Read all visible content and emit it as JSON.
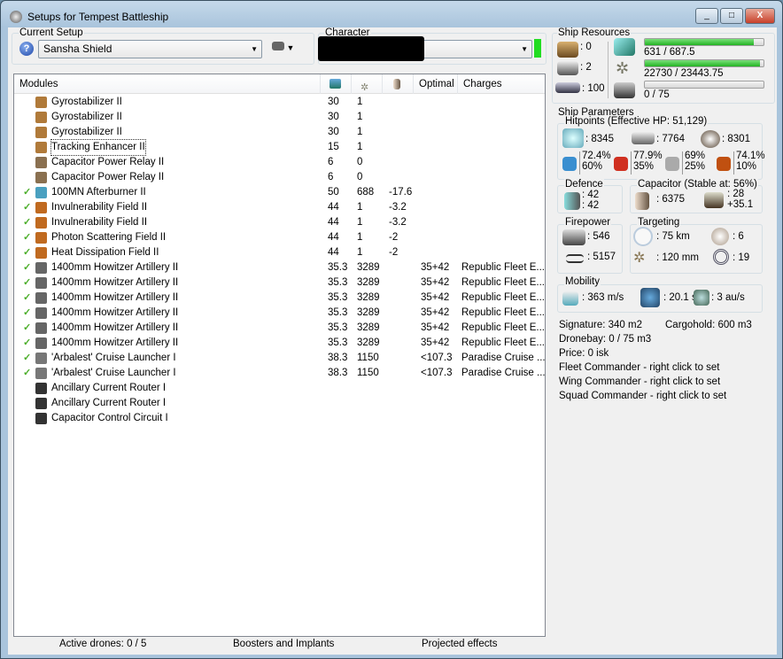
{
  "window": {
    "title": "Setups for Tempest Battleship",
    "min": "_",
    "max": "□",
    "close": "X"
  },
  "setup": {
    "label": "Current Setup",
    "value": "Sansha Shield"
  },
  "character": {
    "label": "Character",
    "value": ""
  },
  "modules": {
    "headers": [
      "Modules",
      "",
      "",
      "",
      "Optimal",
      "Charges"
    ],
    "rows": [
      {
        "active": false,
        "icon": "gyrostabilizer-icon",
        "name": "Gyrostabilizer II",
        "cpu": "30",
        "pg": "1",
        "cap": "",
        "optimal": "",
        "charges": "",
        "color": "#b07a3a"
      },
      {
        "active": false,
        "icon": "gyrostabilizer-icon",
        "name": "Gyrostabilizer II",
        "cpu": "30",
        "pg": "1",
        "cap": "",
        "optimal": "",
        "charges": "",
        "color": "#b07a3a"
      },
      {
        "active": false,
        "icon": "gyrostabilizer-icon",
        "name": "Gyrostabilizer II",
        "cpu": "30",
        "pg": "1",
        "cap": "",
        "optimal": "",
        "charges": "",
        "color": "#b07a3a"
      },
      {
        "active": false,
        "icon": "tracking-enhancer-icon",
        "name": "Tracking Enhancer II",
        "cpu": "15",
        "pg": "1",
        "cap": "",
        "optimal": "",
        "charges": "",
        "color": "#b07a3a"
      },
      {
        "active": false,
        "icon": "capacitor-relay-icon",
        "name": "Capacitor Power Relay II",
        "cpu": "6",
        "pg": "0",
        "cap": "",
        "optimal": "",
        "charges": "",
        "color": "#8a7050"
      },
      {
        "active": false,
        "icon": "capacitor-relay-icon",
        "name": "Capacitor Power Relay II",
        "cpu": "6",
        "pg": "0",
        "cap": "",
        "optimal": "",
        "charges": "",
        "color": "#8a7050"
      },
      {
        "active": true,
        "icon": "afterburner-icon",
        "name": "100MN Afterburner II",
        "cpu": "50",
        "pg": "688",
        "cap": "-17.6",
        "optimal": "",
        "charges": "",
        "color": "#4aa0c0"
      },
      {
        "active": true,
        "icon": "shield-hardener-icon",
        "name": "Invulnerability Field II",
        "cpu": "44",
        "pg": "1",
        "cap": "-3.2",
        "optimal": "",
        "charges": "",
        "color": "#c06a20"
      },
      {
        "active": true,
        "icon": "shield-hardener-icon",
        "name": "Invulnerability Field II",
        "cpu": "44",
        "pg": "1",
        "cap": "-3.2",
        "optimal": "",
        "charges": "",
        "color": "#c06a20"
      },
      {
        "active": true,
        "icon": "shield-hardener-icon",
        "name": "Photon Scattering Field II",
        "cpu": "44",
        "pg": "1",
        "cap": "-2",
        "optimal": "",
        "charges": "",
        "color": "#c06a20"
      },
      {
        "active": true,
        "icon": "shield-hardener-icon",
        "name": "Heat Dissipation Field II",
        "cpu": "44",
        "pg": "1",
        "cap": "-2",
        "optimal": "",
        "charges": "",
        "color": "#c06a20"
      },
      {
        "active": true,
        "icon": "artillery-icon",
        "name": "1400mm Howitzer Artillery II",
        "cpu": "35.3",
        "pg": "3289",
        "cap": "",
        "optimal": "35+42",
        "charges": "Republic Fleet E...",
        "color": "#666"
      },
      {
        "active": true,
        "icon": "artillery-icon",
        "name": "1400mm Howitzer Artillery II",
        "cpu": "35.3",
        "pg": "3289",
        "cap": "",
        "optimal": "35+42",
        "charges": "Republic Fleet E...",
        "color": "#666"
      },
      {
        "active": true,
        "icon": "artillery-icon",
        "name": "1400mm Howitzer Artillery II",
        "cpu": "35.3",
        "pg": "3289",
        "cap": "",
        "optimal": "35+42",
        "charges": "Republic Fleet E...",
        "color": "#666"
      },
      {
        "active": true,
        "icon": "artillery-icon",
        "name": "1400mm Howitzer Artillery II",
        "cpu": "35.3",
        "pg": "3289",
        "cap": "",
        "optimal": "35+42",
        "charges": "Republic Fleet E...",
        "color": "#666"
      },
      {
        "active": true,
        "icon": "artillery-icon",
        "name": "1400mm Howitzer Artillery II",
        "cpu": "35.3",
        "pg": "3289",
        "cap": "",
        "optimal": "35+42",
        "charges": "Republic Fleet E...",
        "color": "#666"
      },
      {
        "active": true,
        "icon": "artillery-icon",
        "name": "1400mm Howitzer Artillery II",
        "cpu": "35.3",
        "pg": "3289",
        "cap": "",
        "optimal": "35+42",
        "charges": "Republic Fleet E...",
        "color": "#666"
      },
      {
        "active": true,
        "icon": "launcher-icon",
        "name": "'Arbalest' Cruise Launcher I",
        "cpu": "38.3",
        "pg": "1150",
        "cap": "",
        "optimal": "<107.3",
        "charges": "Paradise Cruise ...",
        "color": "#777"
      },
      {
        "active": true,
        "icon": "launcher-icon",
        "name": "'Arbalest' Cruise Launcher I",
        "cpu": "38.3",
        "pg": "1150",
        "cap": "",
        "optimal": "<107.3",
        "charges": "Paradise Cruise ...",
        "color": "#777"
      },
      {
        "active": false,
        "icon": "rig-icon",
        "name": "Ancillary Current Router I",
        "cpu": "",
        "pg": "",
        "cap": "",
        "optimal": "",
        "charges": "",
        "color": "#333"
      },
      {
        "active": false,
        "icon": "rig-icon",
        "name": "Ancillary Current Router I",
        "cpu": "",
        "pg": "",
        "cap": "",
        "optimal": "",
        "charges": "",
        "color": "#333"
      },
      {
        "active": false,
        "icon": "rig-icon",
        "name": "Capacitor Control Circuit I",
        "cpu": "",
        "pg": "",
        "cap": "",
        "optimal": "",
        "charges": "",
        "color": "#333"
      }
    ]
  },
  "resources": {
    "label": "Ship Resources",
    "turrets": ": 0",
    "launchers": ": 2",
    "calibration": ": 100",
    "cpu": {
      "text": "631 / 687.5",
      "fraction": 0.918
    },
    "powergrid": {
      "text": "22730 / 23443.75",
      "fraction": 0.97
    },
    "drone_bandwidth": {
      "text": "0 / 75",
      "fraction": 0
    }
  },
  "params": {
    "label": "Ship Parameters",
    "hitpoints_label": "Hitpoints (Effective HP: 51,129)",
    "shield": ": 8345",
    "armor": ": 7764",
    "hull": ": 8301",
    "resists": [
      {
        "a": "72.4%",
        "b": "60%"
      },
      {
        "a": "77.9%",
        "b": "35%"
      },
      {
        "a": "69%",
        "b": "25%"
      },
      {
        "a": "74.1%",
        "b": "10%"
      }
    ],
    "defence_label": "Defence",
    "defence_a": ": 42",
    "defence_b": ": 42",
    "capacitor_label": "Capacitor (Stable at: 56%)",
    "cap_amount": ": 6375",
    "cap_a": ": 28",
    "cap_b": "+35.1",
    "firepower_label": "Firepower",
    "dps": ": 546",
    "volley": ": 5157",
    "targeting_label": "Targeting",
    "range": ": 75 km",
    "targets": ": 6",
    "scan_res": ": 120 mm",
    "sensor": ": 19",
    "mobility_label": "Mobility",
    "speed": ": 363 m/s",
    "align": ": 20.1 s",
    "warp": ": 3 au/s",
    "signature": "Signature: 340 m2",
    "cargohold": "Cargohold: 600 m3",
    "dronebay": "Dronebay: 0 / 75 m3",
    "price": "Price: 0 isk",
    "fleet": "Fleet Commander - right click to set",
    "wing": "Wing Commander - right click to set",
    "squad": "Squad Commander - right click to set"
  },
  "footer": {
    "drones": "Active drones: 0 / 5",
    "boosters": "Boosters and Implants",
    "projected": "Projected effects"
  }
}
